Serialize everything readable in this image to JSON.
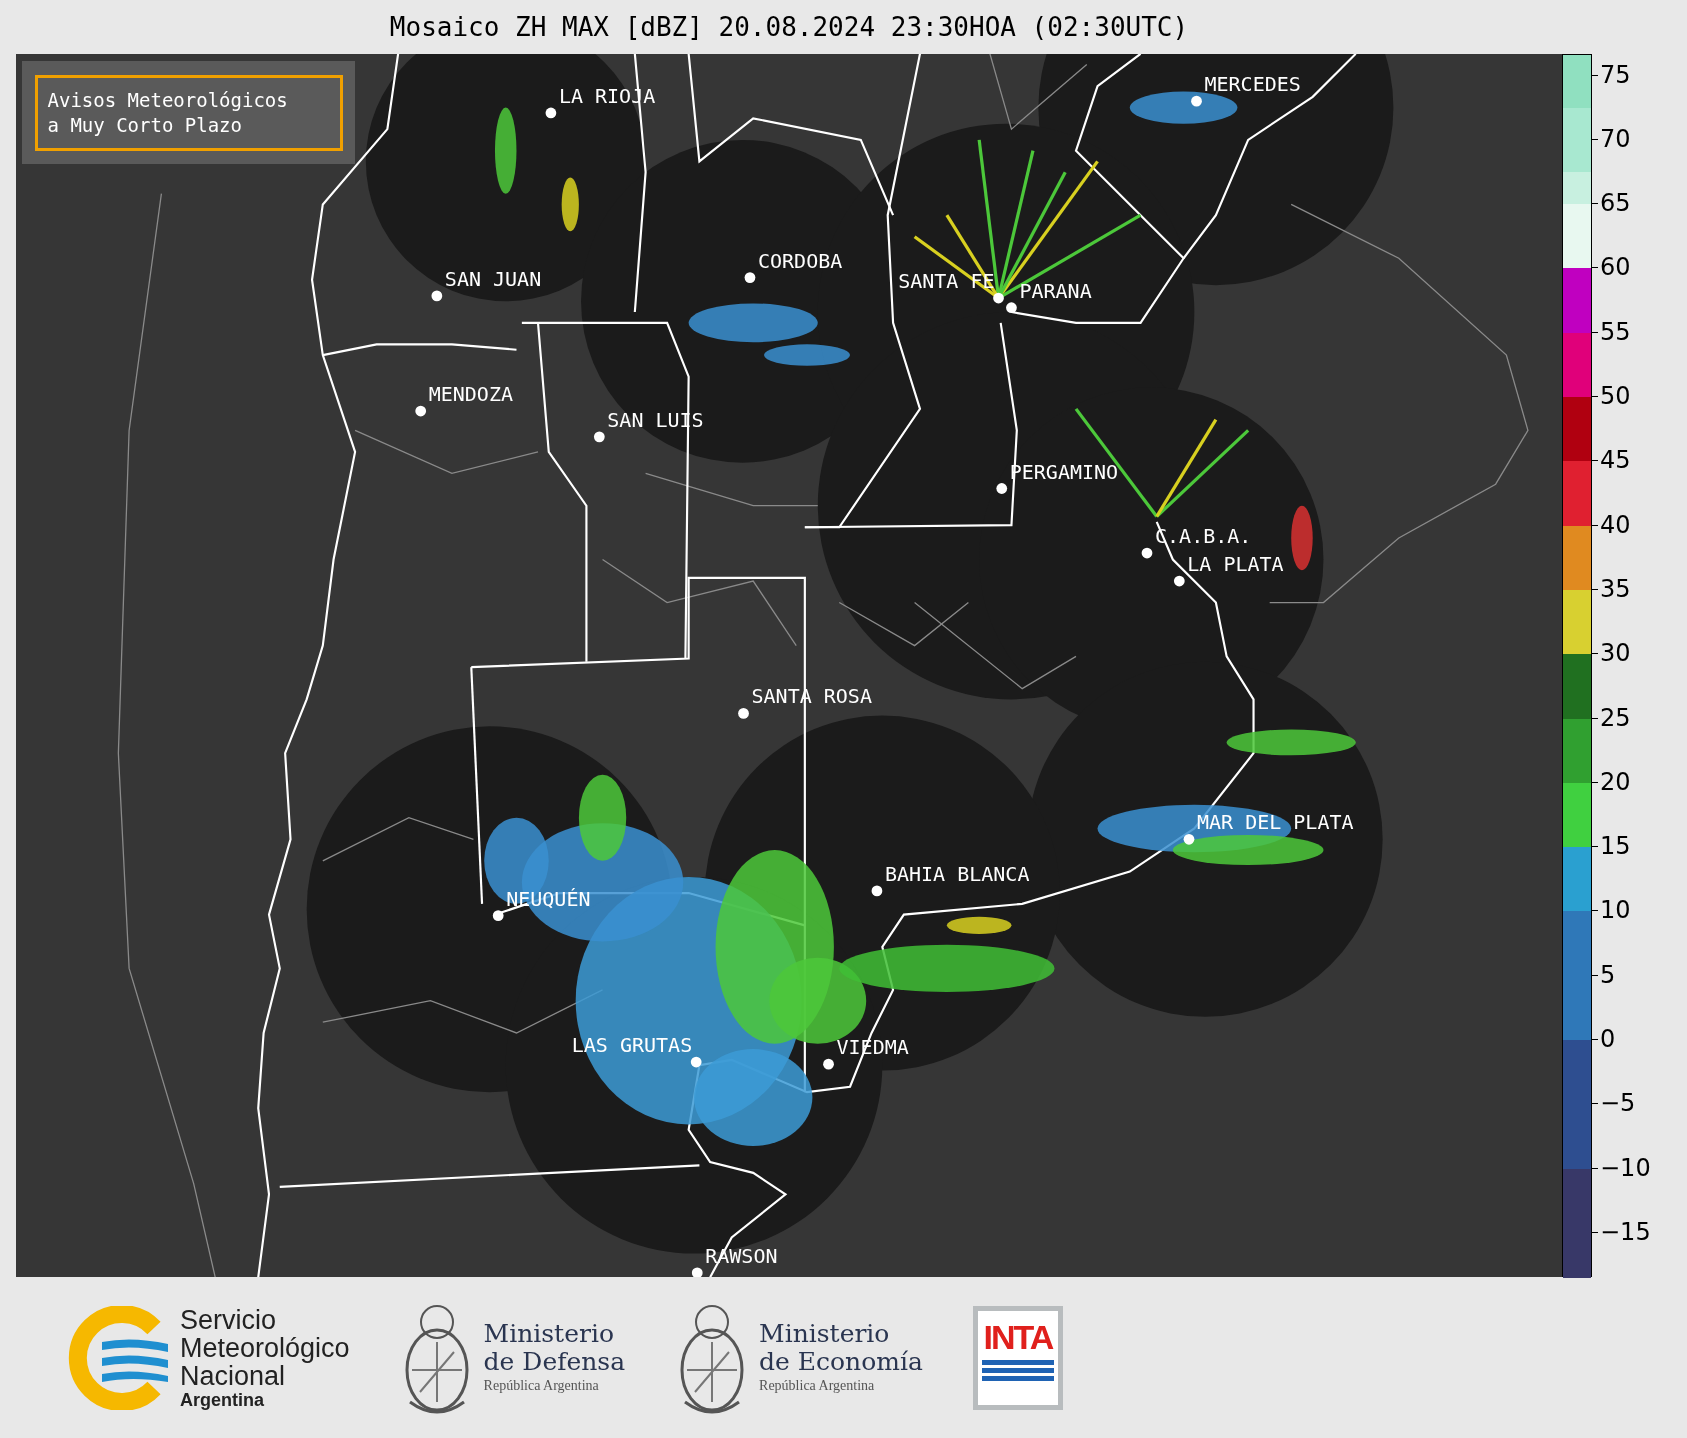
{
  "title": "Mosaico ZH MAX [dBZ] 20.08.2024 23:30HOA (02:30UTC)",
  "warning_box": {
    "text": "Avisos Meteorológicos\na Muy Corto Plazo"
  },
  "cities": [
    {
      "name": "LA RIOJA"
    },
    {
      "name": "MERCEDES"
    },
    {
      "name": "CORDOBA"
    },
    {
      "name": "SAN JUAN"
    },
    {
      "name": "SANTA FE"
    },
    {
      "name": "PARANA"
    },
    {
      "name": "MENDOZA"
    },
    {
      "name": "SAN LUIS"
    },
    {
      "name": "PERGAMINO"
    },
    {
      "name": "C.A.B.A."
    },
    {
      "name": "LA PLATA"
    },
    {
      "name": "SANTA ROSA"
    },
    {
      "name": "MAR DEL PLATA"
    },
    {
      "name": "BAHIA BLANCA"
    },
    {
      "name": "NEUQUÉN"
    },
    {
      "name": "LAS GRUTAS"
    },
    {
      "name": "VIEDMA"
    },
    {
      "name": "RAWSON"
    }
  ],
  "colorbar": {
    "ticks": [
      "75",
      "70",
      "65",
      "60",
      "55",
      "50",
      "45",
      "40",
      "35",
      "30",
      "25",
      "20",
      "15",
      "10",
      "5",
      "0",
      "−5",
      "−10",
      "−15"
    ]
  },
  "logos": [
    {
      "kind": "smn",
      "title": "Servicio\nMeteorológico\nNacional",
      "subtitle": "Argentina"
    },
    {
      "kind": "ministry",
      "title": "Ministerio\nde Defensa",
      "subtitle": "República Argentina"
    },
    {
      "kind": "ministry",
      "title": "Ministerio\nde Economía",
      "subtitle": "República Argentina"
    },
    {
      "kind": "inta",
      "title": "INTA"
    }
  ]
}
